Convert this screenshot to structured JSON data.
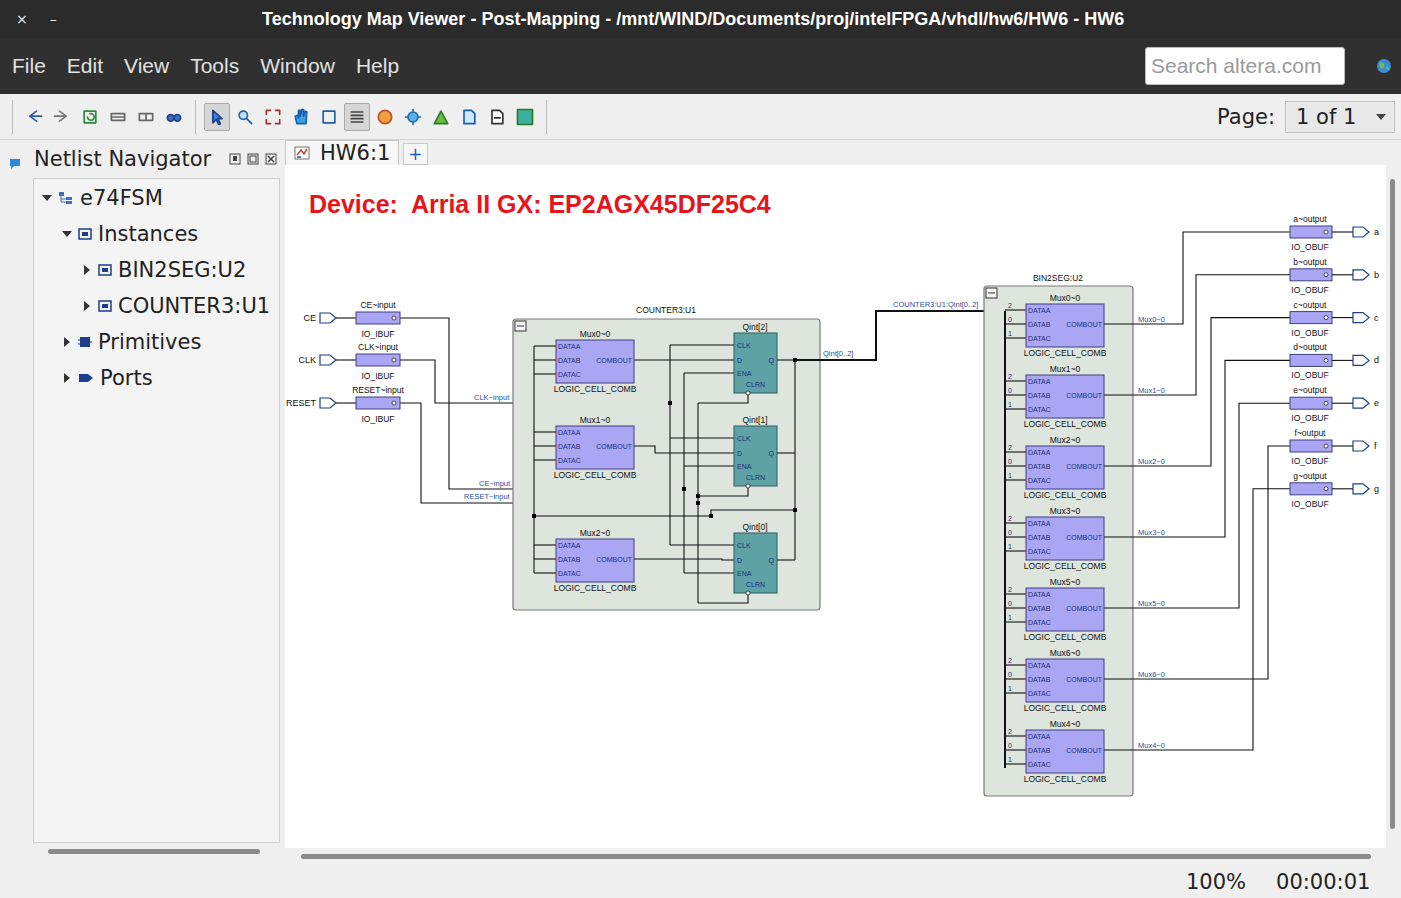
{
  "window": {
    "title": "Technology Map Viewer - Post-Mapping - /mnt/WIND/Documents/proj/intelFPGA/vhdl/hw6/HW6 - HW6",
    "controls": [
      "×",
      "–"
    ]
  },
  "menu": [
    "File",
    "Edit",
    "View",
    "Tools",
    "Window",
    "Help"
  ],
  "search": {
    "placeholder": "Search altera.com"
  },
  "toolbar": {
    "buttons": [
      {
        "selected": false
      },
      {
        "selected": false
      },
      {
        "selected": false
      },
      {
        "selected": false
      },
      {
        "selected": false
      },
      {
        "selected": false
      },
      {
        "selected": true
      },
      {
        "selected": false
      },
      {
        "selected": false
      },
      {
        "selected": false
      },
      {
        "selected": false
      },
      {
        "selected": true
      },
      {
        "selected": false
      },
      {
        "selected": false
      },
      {
        "selected": false
      },
      {
        "selected": false
      },
      {
        "selected": false
      },
      {
        "selected": false
      }
    ],
    "page_label": "Page:",
    "page_value": "1 of 1"
  },
  "navigator": {
    "title": "Netlist Navigator",
    "items": [
      {
        "label": "e74FSM",
        "level": 0,
        "expanded": true,
        "kind": "design"
      },
      {
        "label": "Instances",
        "level": 1,
        "expanded": true,
        "kind": "box"
      },
      {
        "label": "BIN2SEG:U2",
        "level": 2,
        "expanded": false,
        "kind": "box"
      },
      {
        "label": "COUNTER3:U1",
        "level": 2,
        "expanded": false,
        "kind": "box"
      },
      {
        "label": "Primitives",
        "level": 1,
        "expanded": false,
        "kind": "primitives"
      },
      {
        "label": "Ports",
        "level": 1,
        "expanded": false,
        "kind": "ports"
      }
    ]
  },
  "tabs": [
    {
      "label": "HW6:1",
      "selected": true
    }
  ],
  "tab_add": "+",
  "diagram": {
    "device": "Device:  Arria II GX: EP2AGX45DF25C4",
    "inputs": [
      {
        "port": "CE",
        "cell": "CE~input",
        "type": "IO_IBUF",
        "net": "CE~input"
      },
      {
        "port": "CLK",
        "cell": "CLK~input",
        "type": "IO_IBUF",
        "net": "CLK~input"
      },
      {
        "port": "RESET",
        "cell": "RESET~input",
        "type": "IO_IBUF",
        "net": "RESET~input"
      }
    ],
    "counter": {
      "name": "COUNTER3:U1",
      "luts": [
        {
          "name": "Mux0~0",
          "inputs": [
            "DATAA",
            "DATAB",
            "DATAC"
          ],
          "output": "COMBOUT",
          "type": "LOGIC_CELL_COMB"
        },
        {
          "name": "Mux1~0",
          "inputs": [
            "DATAA",
            "DATAB",
            "DATAC"
          ],
          "output": "COMBOUT",
          "type": "LOGIC_CELL_COMB"
        },
        {
          "name": "Mux2~0",
          "inputs": [
            "DATAA",
            "DATAB",
            "DATAC"
          ],
          "output": "COMBOUT",
          "type": "LOGIC_CELL_COMB"
        }
      ],
      "registers": [
        {
          "name": "Qint[2]",
          "inputs": [
            "CLK",
            "D",
            "ENA",
            "CLRN"
          ],
          "output": "Q"
        },
        {
          "name": "Qint[1]",
          "inputs": [
            "CLK",
            "D",
            "ENA",
            "CLRN"
          ],
          "output": "Q"
        },
        {
          "name": "Qint[0]",
          "inputs": [
            "CLK",
            "D",
            "ENA",
            "CLRN"
          ],
          "output": "Q"
        }
      ],
      "bus": "Qint[0..2]"
    },
    "link": "COUNTER3:U1:Qint[0..2]",
    "decoder": {
      "name": "BIN2SEG:U2",
      "luts": [
        {
          "name": "Mux0~0",
          "taps": [
            "2",
            "0",
            "1"
          ],
          "inputs": [
            "DATAA",
            "DATAB",
            "DATAC"
          ],
          "output": "COMBOUT",
          "type": "LOGIC_CELL_COMB",
          "net": "Mux0~0"
        },
        {
          "name": "Mux1~0",
          "taps": [
            "2",
            "0",
            "1"
          ],
          "inputs": [
            "DATAA",
            "DATAB",
            "DATAC"
          ],
          "output": "COMBOUT",
          "type": "LOGIC_CELL_COMB",
          "net": "Mux1~0"
        },
        {
          "name": "Mux2~0",
          "taps": [
            "2",
            "0",
            "1"
          ],
          "inputs": [
            "DATAA",
            "DATAB",
            "DATAC"
          ],
          "output": "COMBOUT",
          "type": "LOGIC_CELL_COMB",
          "net": "Mux2~0"
        },
        {
          "name": "Mux3~0",
          "taps": [
            "2",
            "0",
            "1"
          ],
          "inputs": [
            "DATAA",
            "DATAB",
            "DATAC"
          ],
          "output": "COMBOUT",
          "type": "LOGIC_CELL_COMB",
          "net": "Mux3~0"
        },
        {
          "name": "Mux5~0",
          "taps": [
            "2",
            "0",
            "1"
          ],
          "inputs": [
            "DATAA",
            "DATAB",
            "DATAC"
          ],
          "output": "COMBOUT",
          "type": "LOGIC_CELL_COMB",
          "net": "Mux5~0"
        },
        {
          "name": "Mux6~0",
          "taps": [
            "2",
            "0",
            "1"
          ],
          "inputs": [
            "DATAA",
            "DATAB",
            "DATAC"
          ],
          "output": "COMBOUT",
          "type": "LOGIC_CELL_COMB",
          "net": "Mux6~0"
        },
        {
          "name": "Mux4~0",
          "taps": [
            "2",
            "0",
            "1"
          ],
          "inputs": [
            "DATAA",
            "DATAB",
            "DATAC"
          ],
          "output": "COMBOUT",
          "type": "LOGIC_CELL_COMB",
          "net": "Mux4~0"
        }
      ]
    },
    "outputs": [
      {
        "cell": "a~output",
        "type": "IO_OBUF",
        "port": "a"
      },
      {
        "cell": "b~output",
        "type": "IO_OBUF",
        "port": "b"
      },
      {
        "cell": "c~output",
        "type": "IO_OBUF",
        "port": "c"
      },
      {
        "cell": "d~output",
        "type": "IO_OBUF",
        "port": "d"
      },
      {
        "cell": "e~output",
        "type": "IO_OBUF",
        "port": "e"
      },
      {
        "cell": "f~output",
        "type": "IO_OBUF",
        "port": "f"
      },
      {
        "cell": "g~output",
        "type": "IO_OBUF",
        "port": "g"
      }
    ]
  },
  "status": {
    "zoom": "100%",
    "time": "00:00:01"
  }
}
